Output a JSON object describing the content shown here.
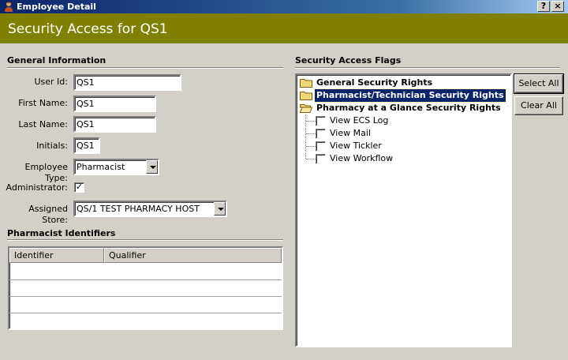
{
  "window": {
    "title": "Employee Detail",
    "help_label": "?",
    "close_label": "×"
  },
  "header": {
    "title": "Security Access for QS1",
    "band_color": "#808000"
  },
  "general": {
    "section_title": "General Information",
    "user_id_label": "User Id:",
    "user_id_value": "QS1",
    "first_name_label": "First Name:",
    "first_name_value": "QS1",
    "last_name_label": "Last Name:",
    "last_name_value": "QS1",
    "initials_label": "Initials:",
    "initials_value": "QS1",
    "employee_type_label": "Employee Type:",
    "employee_type_value": "Pharmacist",
    "administrator_label": "Administrator:",
    "administrator_checked": true,
    "administrator_mark": "✓",
    "assigned_store_label": "Assigned Store:",
    "assigned_store_value": "QS/1 TEST PHARMACY HOST"
  },
  "identifiers": {
    "section_title": "Pharmacist Identifiers",
    "columns": [
      "Identifier",
      "Qualifier"
    ],
    "rows": []
  },
  "security": {
    "section_title": "Security Access Flags",
    "nodes": [
      {
        "label": "General Security Rights",
        "selected": false,
        "icon": "folder-icon"
      },
      {
        "label": "Pharmacist/Technician Security Rights",
        "selected": true,
        "icon": "folder-icon"
      },
      {
        "label": "Pharmacy at a Glance Security Rights",
        "selected": false,
        "icon": "folder-open-icon"
      }
    ],
    "children": [
      {
        "label": "View ECS Log",
        "checked": false
      },
      {
        "label": "View Mail",
        "checked": false
      },
      {
        "label": "View Tickler",
        "checked": false
      },
      {
        "label": "View Workflow",
        "checked": false
      }
    ],
    "select_all_label": "Select All",
    "clear_all_label": "Clear All",
    "selection_color": "#0a246a"
  }
}
